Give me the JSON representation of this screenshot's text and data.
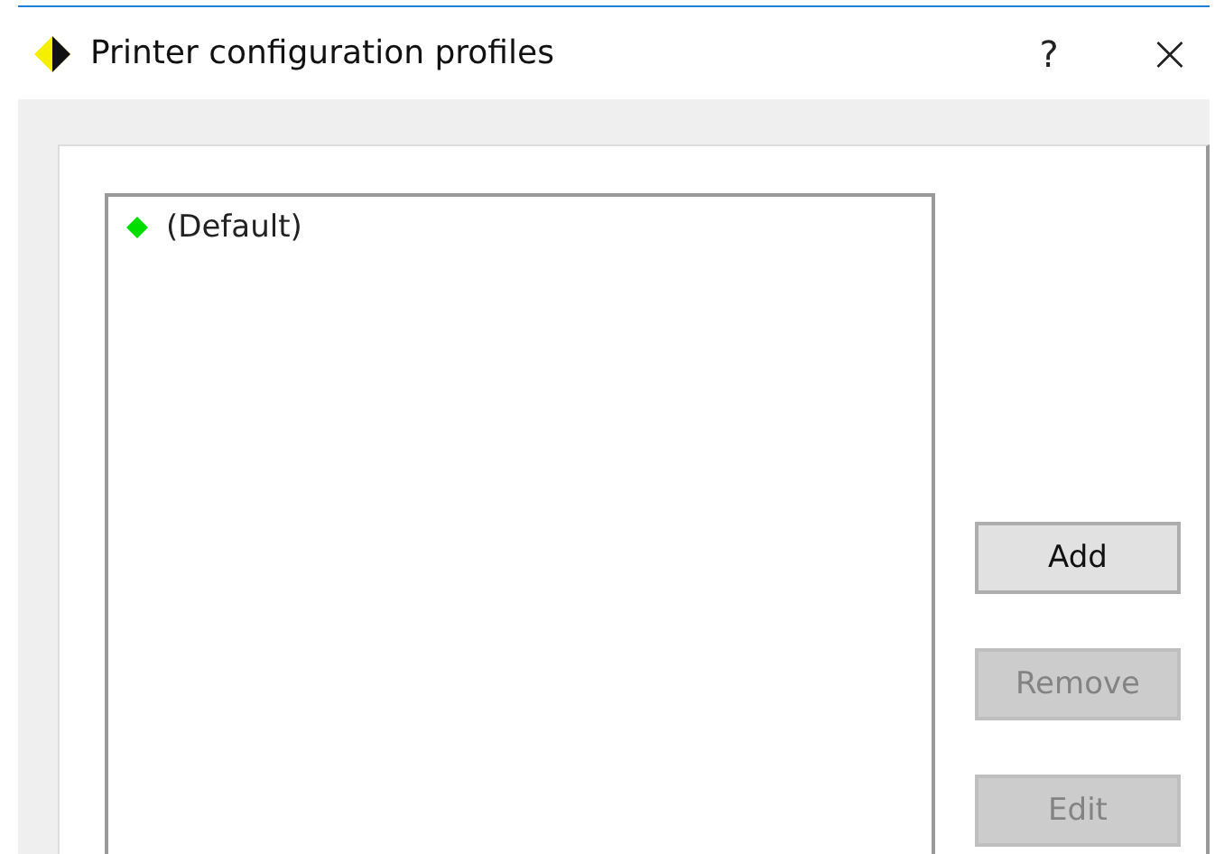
{
  "window": {
    "title": "Printer configuration profiles",
    "help": "?",
    "close": "×"
  },
  "profiles": [
    {
      "label": "(Default)",
      "color": "#00dd00",
      "selected": false
    }
  ],
  "buttons": [
    {
      "label": "Add",
      "disabled": false
    },
    {
      "label": "Remove",
      "disabled": true
    },
    {
      "label": "Edit",
      "disabled": true
    }
  ]
}
